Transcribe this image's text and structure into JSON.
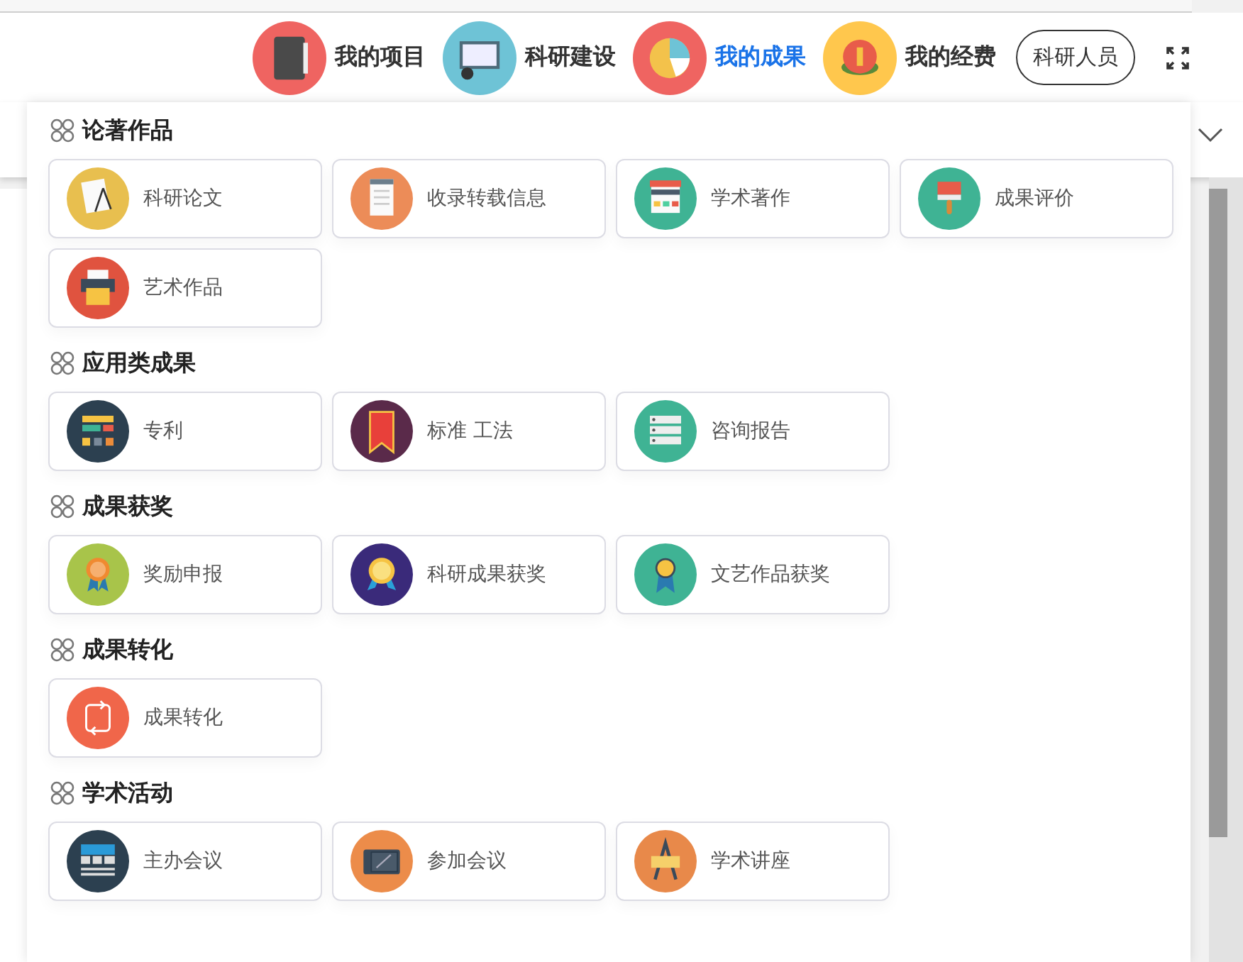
{
  "nav": [
    {
      "label": "我的项目",
      "kind": "notebook",
      "selected": false
    },
    {
      "label": "科研建设",
      "kind": "monitor",
      "selected": false
    },
    {
      "label": "我的成果",
      "kind": "piechart",
      "selected": true
    },
    {
      "label": "我的经费",
      "kind": "coins",
      "selected": false
    }
  ],
  "role_button": "科研人员",
  "sections": [
    {
      "title": "论著作品",
      "items": [
        {
          "label": "科研论文",
          "kind": "papers"
        },
        {
          "label": "收录转载信息",
          "kind": "document"
        },
        {
          "label": "学术著作",
          "kind": "shop"
        },
        {
          "label": "成果评价",
          "kind": "brush"
        },
        {
          "label": "艺术作品",
          "kind": "printer"
        }
      ]
    },
    {
      "title": "应用类成果",
      "items": [
        {
          "label": "专利",
          "kind": "flowchart"
        },
        {
          "label": "标准 工法",
          "kind": "banner"
        },
        {
          "label": "咨询报告",
          "kind": "server"
        }
      ]
    },
    {
      "title": "成果获奖",
      "items": [
        {
          "label": "奖励申报",
          "kind": "rosette"
        },
        {
          "label": "科研成果获奖",
          "kind": "medal"
        },
        {
          "label": "文艺作品获奖",
          "kind": "badge"
        }
      ]
    },
    {
      "title": "成果转化",
      "items": [
        {
          "label": "成果转化",
          "kind": "cycle"
        }
      ]
    },
    {
      "title": "学术活动",
      "items": [
        {
          "label": "主办会议",
          "kind": "board"
        },
        {
          "label": "参加会议",
          "kind": "tablet"
        },
        {
          "label": "学术讲座",
          "kind": "easel"
        }
      ]
    }
  ]
}
